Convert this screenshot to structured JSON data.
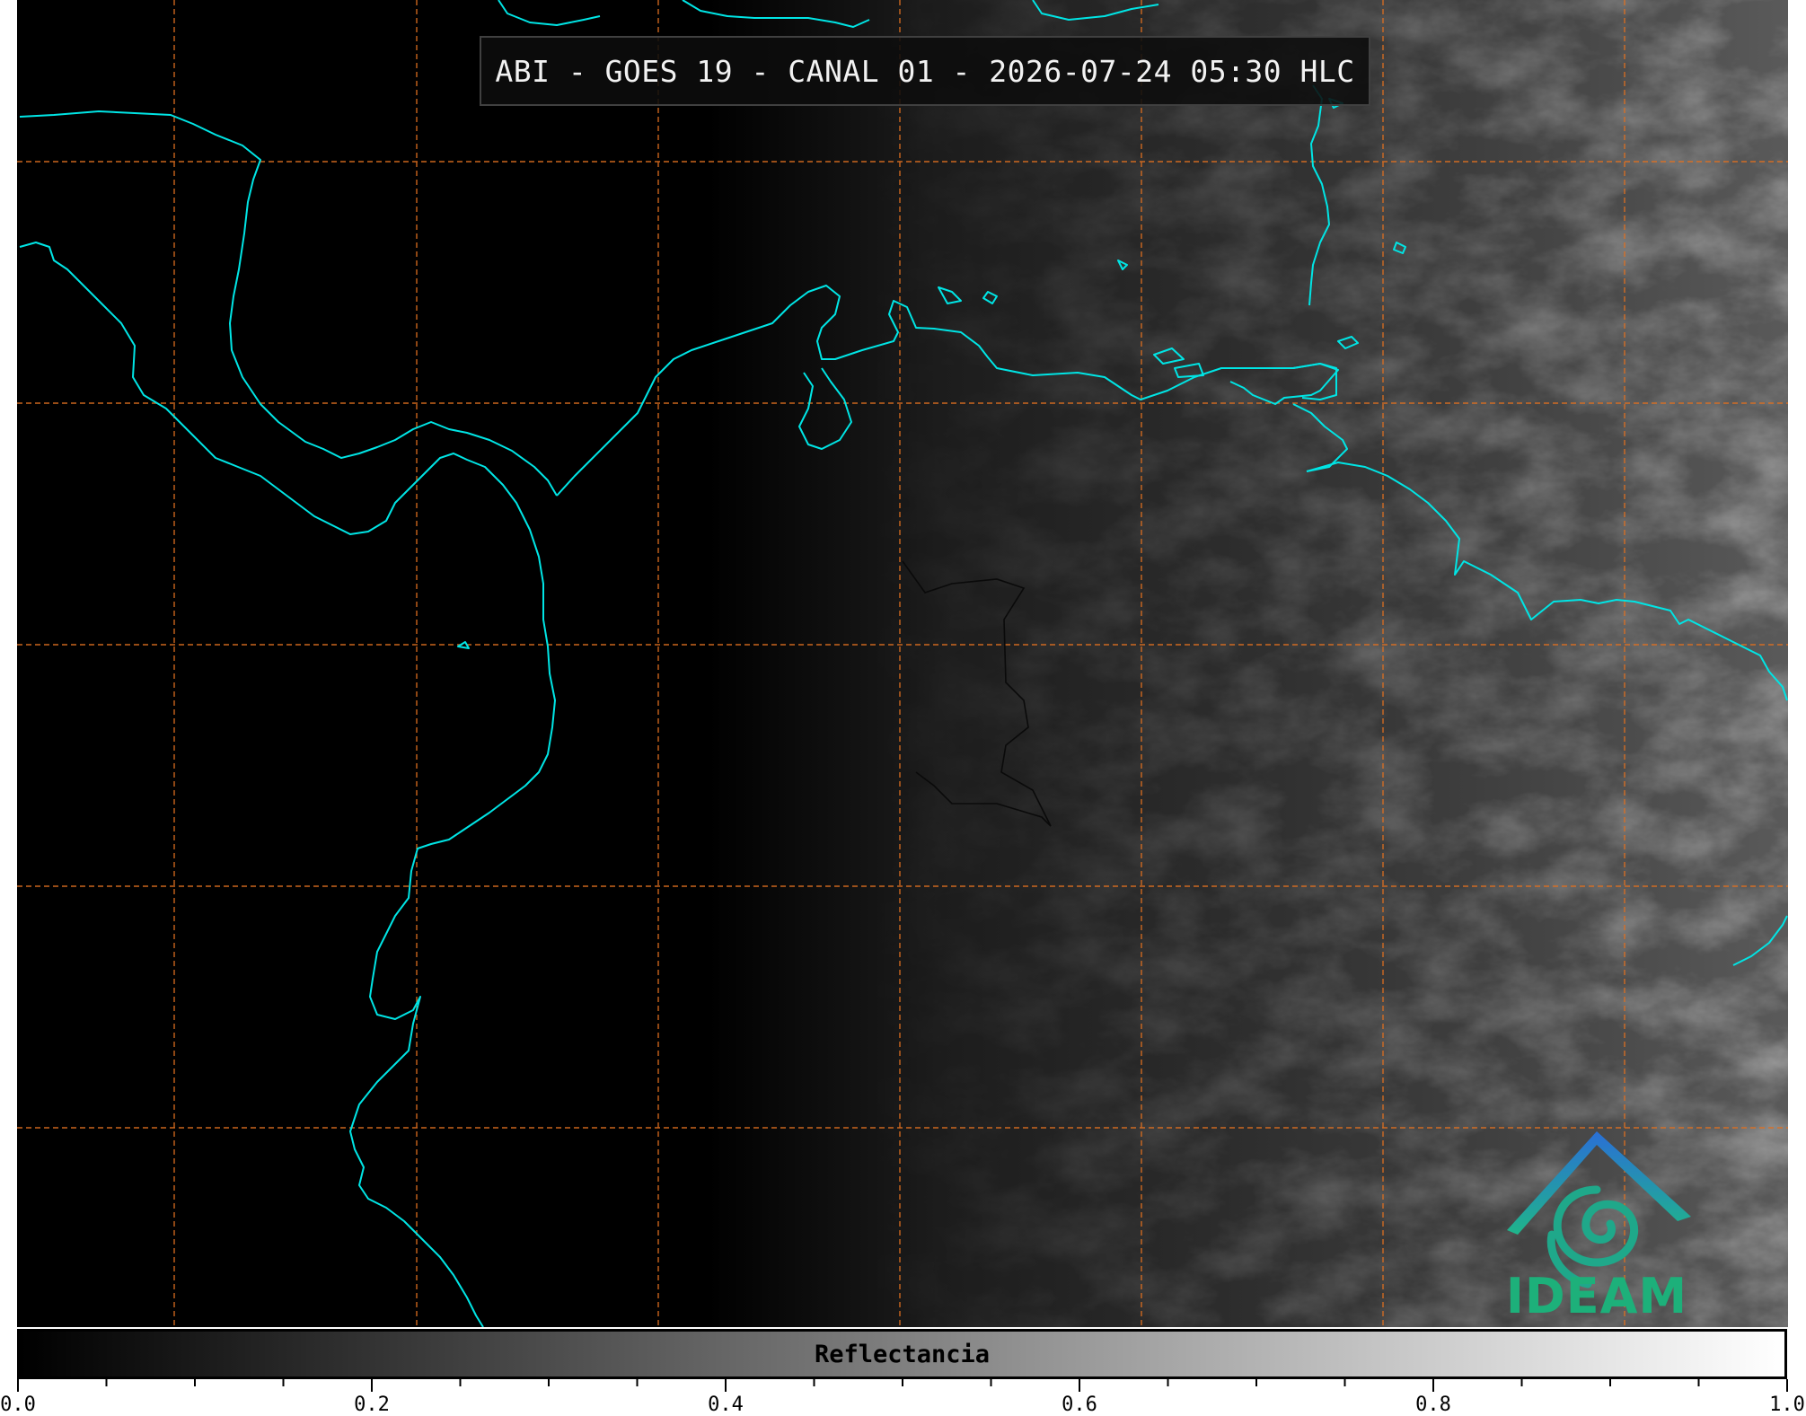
{
  "title": "ABI - GOES 19 - CANAL 01 - 2026-07-24 05:30 HLC",
  "logo": {
    "name": "IDEAM"
  },
  "colorbar": {
    "label": "Reflectancia",
    "min": 0.0,
    "max": 1.0,
    "tick_labels": [
      "0.0",
      "0.2",
      "0.4",
      "0.6",
      "0.8",
      "1.0"
    ],
    "colormap": "grayscale",
    "colors": {
      "low": "#000000",
      "high": "#ffffff"
    }
  },
  "map": {
    "coastline_color": "#00e5e5",
    "border_color": "#000000",
    "grid_color": "#e07020",
    "grid_style": "dashed"
  }
}
